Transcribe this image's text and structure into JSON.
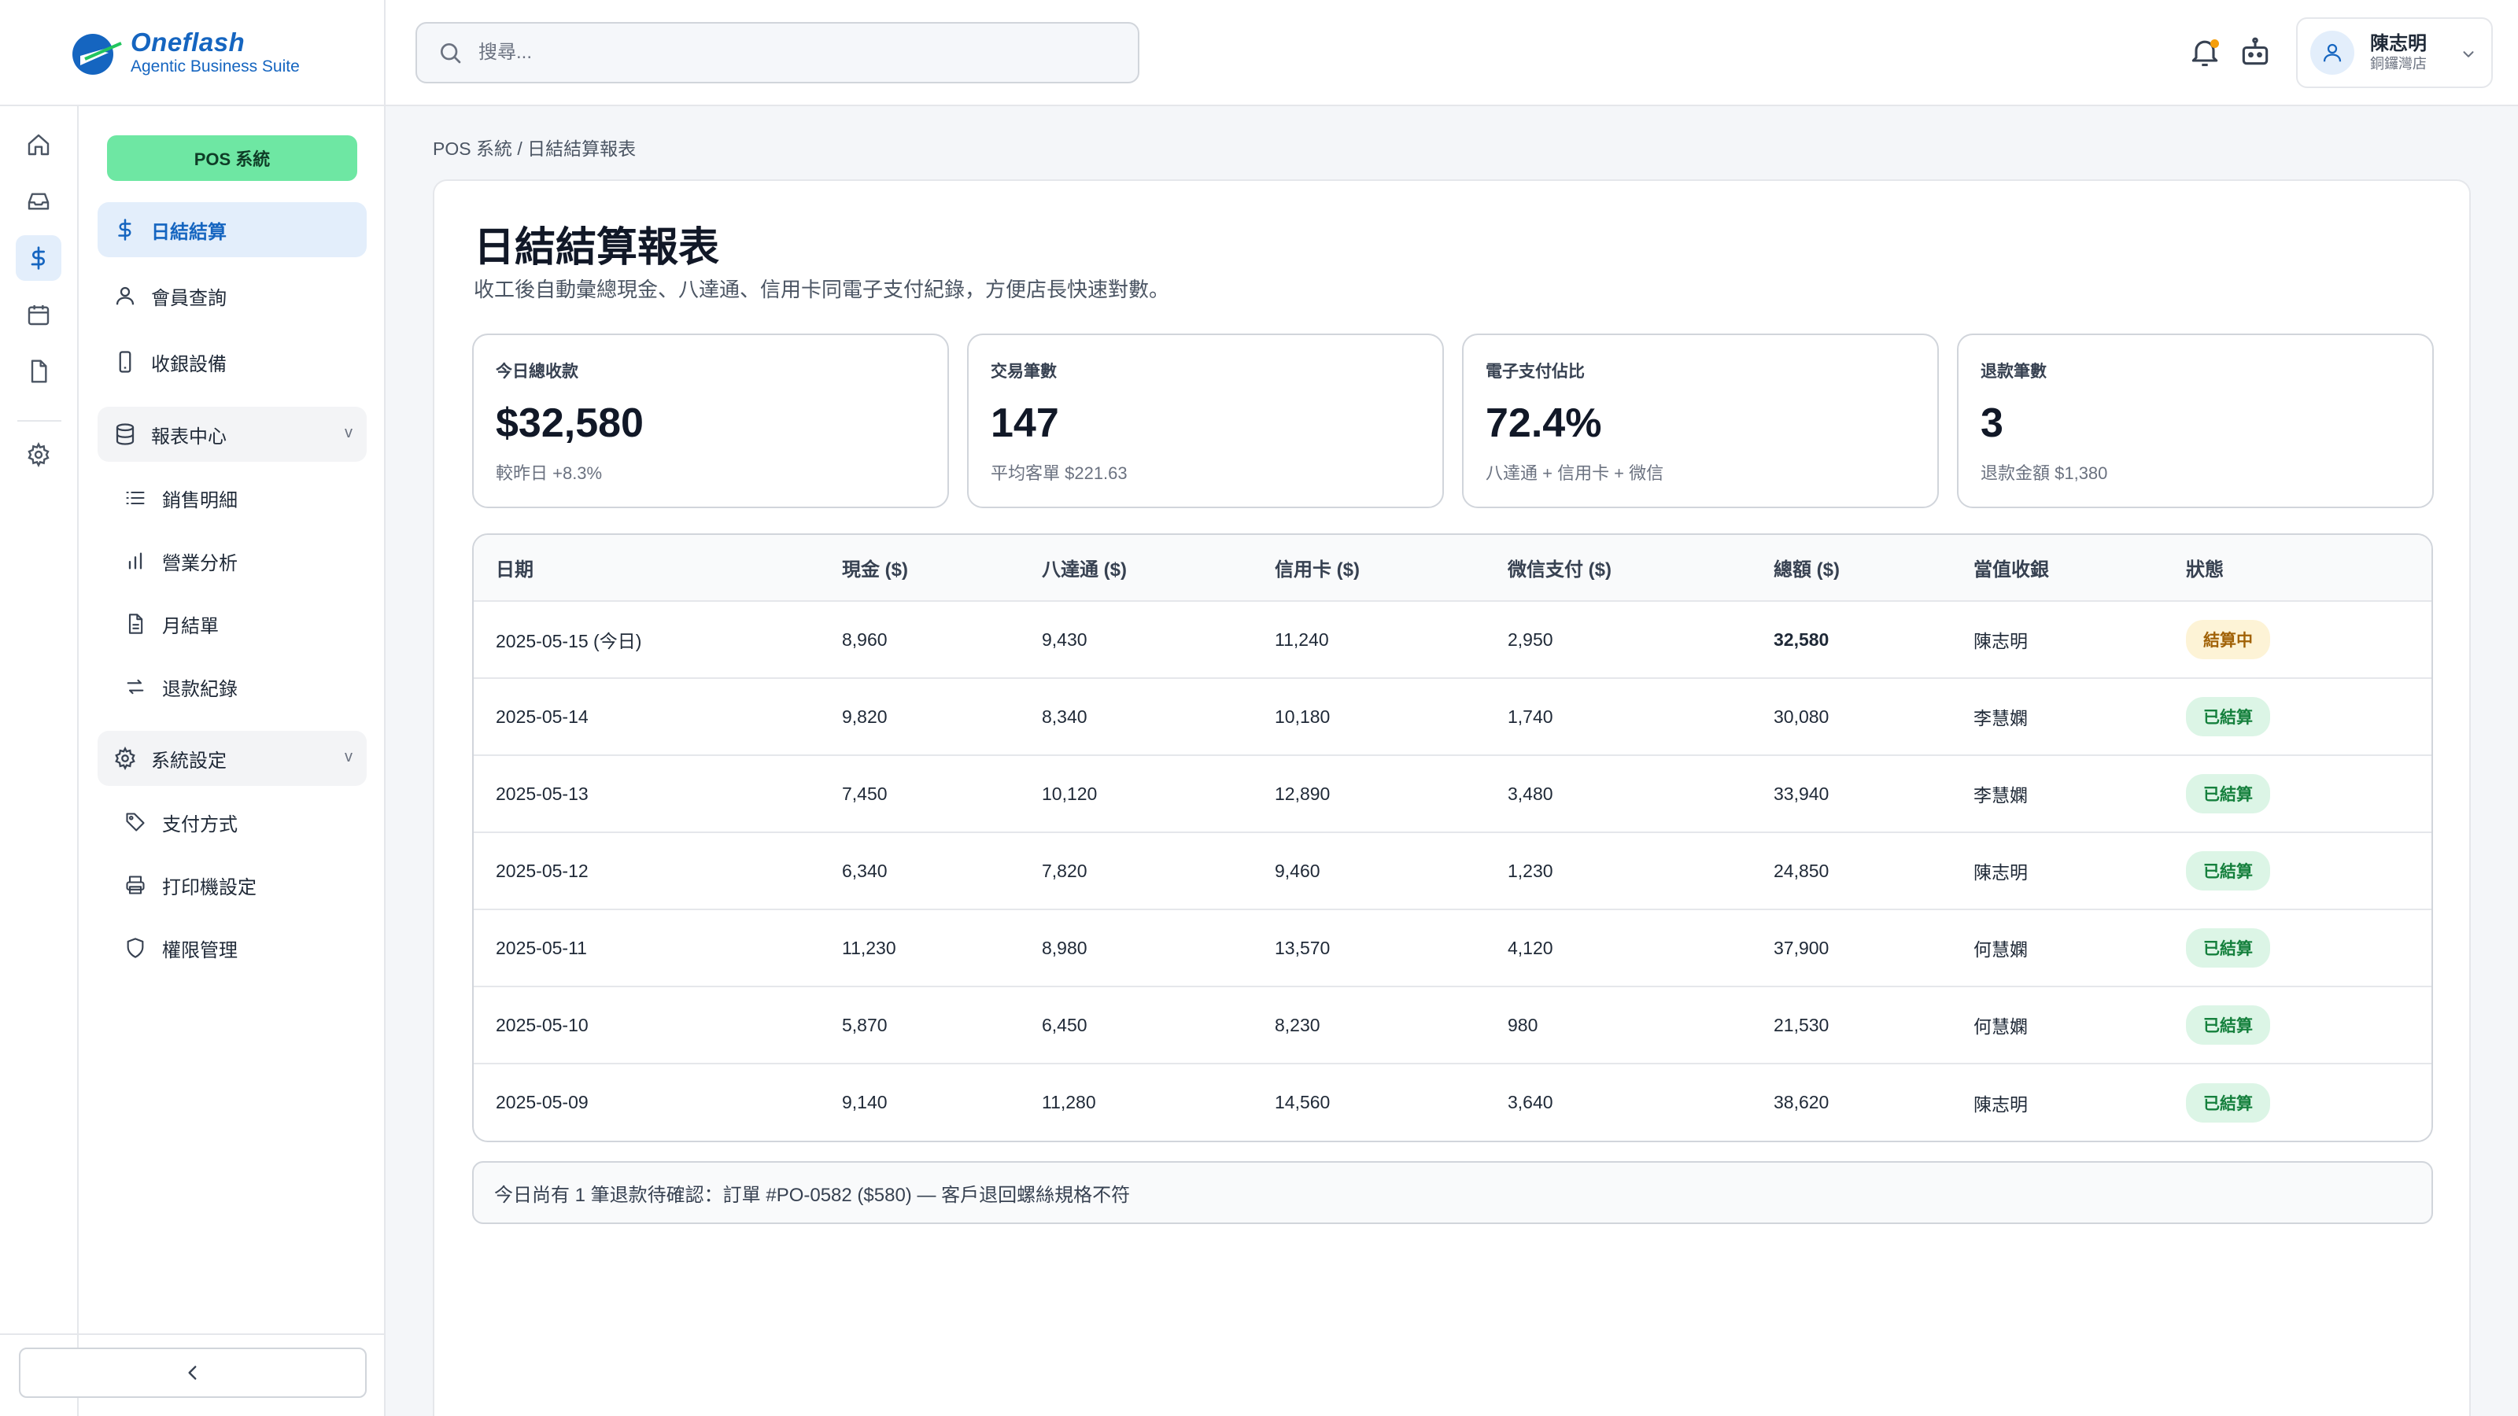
{
  "brand": {
    "name": "Oneflash",
    "tagline": "Agentic Business Suite"
  },
  "search": {
    "placeholder": "搜尋..."
  },
  "user": {
    "name": "陳志明",
    "store": "銅鑼灣店"
  },
  "rail": {
    "icons": [
      "home-icon",
      "inbox-icon",
      "dollar-icon",
      "calendar-icon",
      "file-icon",
      "gear-icon"
    ],
    "active": "dollar-icon"
  },
  "nav": {
    "module_pill": "POS 系統",
    "items": [
      {
        "label": "日結結算",
        "icon": "dollar-icon",
        "active": true
      },
      {
        "label": "會員查詢",
        "icon": "user-icon"
      },
      {
        "label": "收銀設備",
        "icon": "device-icon"
      }
    ],
    "groups": [
      {
        "label": "報表中心",
        "icon": "database-icon",
        "chevron": "v",
        "children": [
          {
            "label": "銷售明細",
            "icon": "list-icon"
          },
          {
            "label": "營業分析",
            "icon": "bar-chart-icon"
          },
          {
            "label": "月結單",
            "icon": "document-icon"
          },
          {
            "label": "退款紀錄",
            "icon": "refund-icon"
          }
        ]
      },
      {
        "label": "系統設定",
        "icon": "gear-icon",
        "chevron": "v",
        "children": [
          {
            "label": "支付方式",
            "icon": "tag-icon"
          },
          {
            "label": "打印機設定",
            "icon": "printer-icon"
          },
          {
            "label": "權限管理",
            "icon": "shield-icon"
          }
        ]
      }
    ],
    "collapse_icon": "chevron-left-icon"
  },
  "breadcrumb": "POS 系統 / 日結結算報表",
  "page": {
    "title": "日結結算報表",
    "subtitle": "收工後自動彙總現金、八達通、信用卡同電子支付紀錄，方便店長快速對數。"
  },
  "kpis": [
    {
      "label": "今日總收款",
      "value": "$32,580",
      "sub": "較昨日 +8.3%"
    },
    {
      "label": "交易筆數",
      "value": "147",
      "sub": "平均客單 $221.63"
    },
    {
      "label": "電子支付佔比",
      "value": "72.4%",
      "sub": "八達通 + 信用卡 + 微信"
    },
    {
      "label": "退款筆數",
      "value": "3",
      "sub": "退款金額 $1,380"
    }
  ],
  "table": {
    "headers": [
      "日期",
      "現金 ($)",
      "八達通 ($)",
      "信用卡 ($)",
      "微信支付 ($)",
      "總額 ($)",
      "當值收銀",
      "狀態"
    ],
    "rows": [
      {
        "date": "2025-05-15 (今日)",
        "cash": "8,960",
        "octopus": "9,430",
        "card": "11,240",
        "wechat": "2,950",
        "total": "32,580",
        "cashier": "陳志明",
        "status": "結算中",
        "status_type": "pending"
      },
      {
        "date": "2025-05-14",
        "cash": "9,820",
        "octopus": "8,340",
        "card": "10,180",
        "wechat": "1,740",
        "total": "30,080",
        "cashier": "李慧嫻",
        "status": "已結算",
        "status_type": "ok"
      },
      {
        "date": "2025-05-13",
        "cash": "7,450",
        "octopus": "10,120",
        "card": "12,890",
        "wechat": "3,480",
        "total": "33,940",
        "cashier": "李慧嫻",
        "status": "已結算",
        "status_type": "ok"
      },
      {
        "date": "2025-05-12",
        "cash": "6,340",
        "octopus": "7,820",
        "card": "9,460",
        "wechat": "1,230",
        "total": "24,850",
        "cashier": "陳志明",
        "status": "已結算",
        "status_type": "ok"
      },
      {
        "date": "2025-05-11",
        "cash": "11,230",
        "octopus": "8,980",
        "card": "13,570",
        "wechat": "4,120",
        "total": "37,900",
        "cashier": "何慧嫻",
        "status": "已結算",
        "status_type": "ok"
      },
      {
        "date": "2025-05-10",
        "cash": "5,870",
        "octopus": "6,450",
        "card": "8,230",
        "wechat": "980",
        "total": "21,530",
        "cashier": "何慧嫻",
        "status": "已結算",
        "status_type": "ok"
      },
      {
        "date": "2025-05-09",
        "cash": "9,140",
        "octopus": "11,280",
        "card": "14,560",
        "wechat": "3,640",
        "total": "38,620",
        "cashier": "陳志明",
        "status": "已結算",
        "status_type": "ok"
      }
    ]
  },
  "notice": "今日尚有 1 筆退款待確認：訂單 #PO-0582 ($580) — 客戶退回螺絲規格不符",
  "colors": {
    "accent": "#1565c0",
    "module_pill": "#6ee7a3",
    "badge_ok": "#dcf5e6",
    "badge_pending": "#fdf3d6",
    "notification_dot": "#f59e0b"
  }
}
